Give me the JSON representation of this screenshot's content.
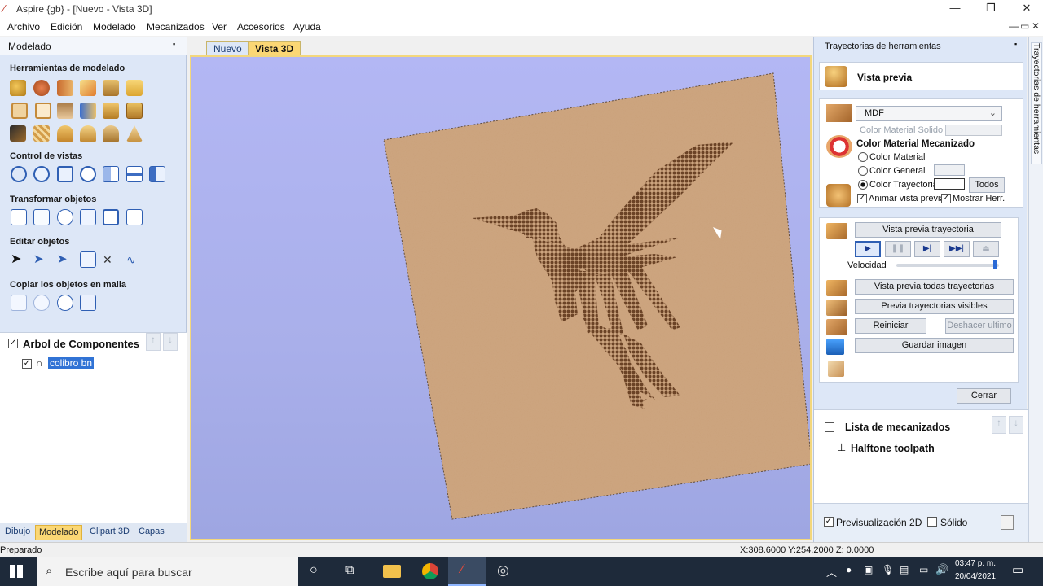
{
  "window": {
    "title": "Aspire {gb} - [Nuevo - Vista 3D]",
    "controls": {
      "minimize": "—",
      "maximize": "❐",
      "close": "✕"
    }
  },
  "menu": {
    "items": [
      "Archivo",
      "Edición",
      "Modelado",
      "Mecanizados",
      "Ver",
      "Accesorios",
      "Ayuda"
    ],
    "right_controls": [
      "—",
      "▭",
      "✕"
    ]
  },
  "left_panel": {
    "title": "Modelado",
    "pin": "📌",
    "sections": {
      "modeling_tools": "Herramientas de modelado",
      "view_control": "Control de vistas",
      "transform": "Transformar objetos",
      "edit": "Editar objetos",
      "copy_grid": "Copiar los objetos en malla"
    },
    "tree": {
      "title": "Arbol de Componentes",
      "item": "colibro bn"
    },
    "tabs": [
      "Dibujo",
      "Modelado",
      "Clipart 3D",
      "Capas"
    ],
    "selected_tab": "Modelado"
  },
  "doc_tabs": [
    "Nuevo",
    "Vista 3D"
  ],
  "selected_doc_tab": "Vista 3D",
  "right_panel": {
    "title": "Trayectorias de herramientas",
    "side_tab": "Trayectorias de herramientas",
    "preview_header": "Vista previa",
    "material": {
      "select_value": "MDF",
      "solid_color_label": "Color Material Solido",
      "machined_color_title": "Color Material Mecanizado",
      "radios": [
        "Color Material",
        "Color General",
        "Color Trayectoria"
      ],
      "selected_radio": "Color Trayectoria",
      "all_button": "Todos",
      "animate_label": "Animar vista previa",
      "show_tool_label": "Mostrar Herr."
    },
    "playback": {
      "preview_toolpath": "Vista previa trayectoria",
      "speed_label": "Velocidad",
      "speed_level": 0.98,
      "preview_all": "Vista previa todas trayectorias",
      "preview_visible": "Previa trayectorias visibles",
      "reset": "Reiniciar",
      "undo_last": "Deshacer ultimo",
      "save_image": "Guardar imagen"
    },
    "close_button": "Cerrar",
    "toolpath_list": {
      "title": "Lista de mecanizados",
      "items": [
        "Halftone toolpath"
      ]
    },
    "bottom": {
      "preview2d": "Previsualización 2D",
      "solid": "Sólido"
    }
  },
  "status": {
    "left": "Preparado",
    "coords": "X:308.6000 Y:254.2000 Z: 0.0000"
  },
  "taskbar": {
    "search_placeholder": "Escribe aquí para buscar",
    "time": "03:47 p. m.",
    "date": "20/04/2021"
  },
  "colors": {
    "accent": "#fbd774",
    "panel": "#dde7f7",
    "viewport": "#b3b7f4",
    "material": "#caa17a",
    "toolpath": "#6b4326"
  }
}
